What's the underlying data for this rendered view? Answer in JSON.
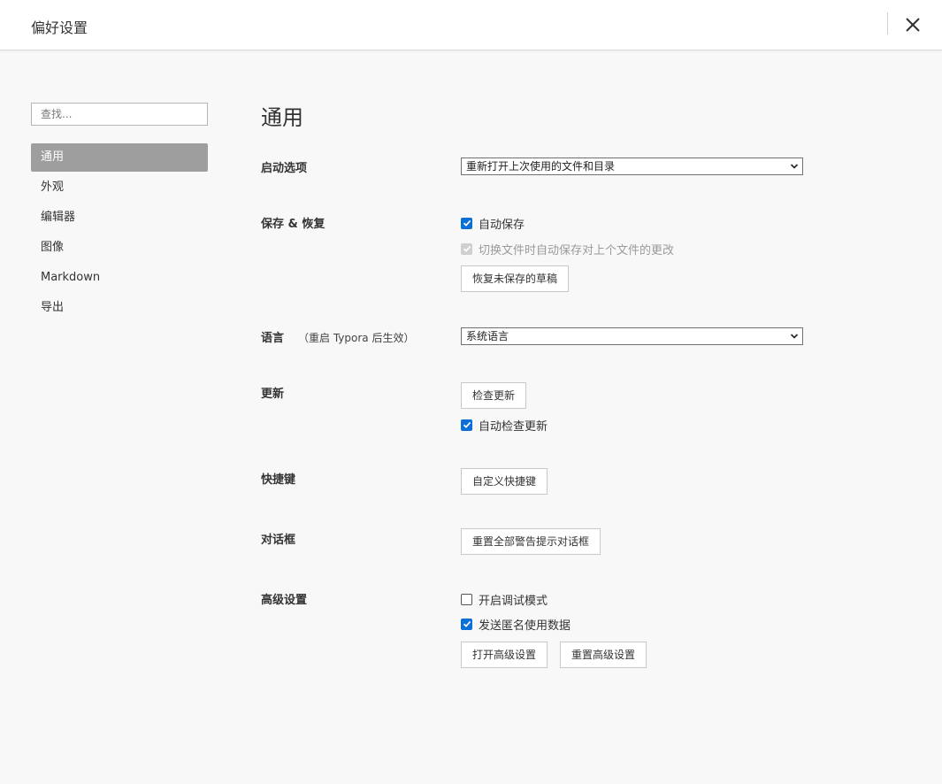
{
  "window": {
    "title": "偏好设置"
  },
  "search": {
    "placeholder": "查找..."
  },
  "sidebar": {
    "items": [
      {
        "label": "通用",
        "active": true
      },
      {
        "label": "外观"
      },
      {
        "label": "编辑器"
      },
      {
        "label": "图像"
      },
      {
        "label": "Markdown"
      },
      {
        "label": "导出"
      }
    ]
  },
  "main": {
    "title": "通用",
    "startup": {
      "label": "启动选项",
      "selected": "重新打开上次使用的文件和目录"
    },
    "save": {
      "label": "保存 & 恢复",
      "autosave_label": "自动保存",
      "autosave_checked": true,
      "switch_save_label": "切换文件时自动保存对上个文件的更改",
      "switch_save_checked": true,
      "switch_save_disabled": true,
      "recover_button": "恢复未保存的草稿"
    },
    "language": {
      "label": "语言",
      "hint": "（重启 Typora 后生效）",
      "selected": "系统语言"
    },
    "update": {
      "label": "更新",
      "check_button": "检查更新",
      "auto_check_label": "自动检查更新",
      "auto_check_checked": true
    },
    "shortcuts": {
      "label": "快捷键",
      "customize_button": "自定义快捷键"
    },
    "dialogs": {
      "label": "对话框",
      "reset_button": "重置全部警告提示对话框"
    },
    "advanced": {
      "label": "高级设置",
      "debug_label": "开启调试模式",
      "debug_checked": false,
      "telemetry_label": "发送匿名使用数据",
      "telemetry_checked": true,
      "open_button": "打开高级设置",
      "reset_button": "重置高级设置"
    }
  },
  "colors": {
    "checkbox_accent": "#0a6fd6",
    "sidebar_active_bg": "#9e9e9e",
    "page_bg": "#f8f8f8"
  }
}
